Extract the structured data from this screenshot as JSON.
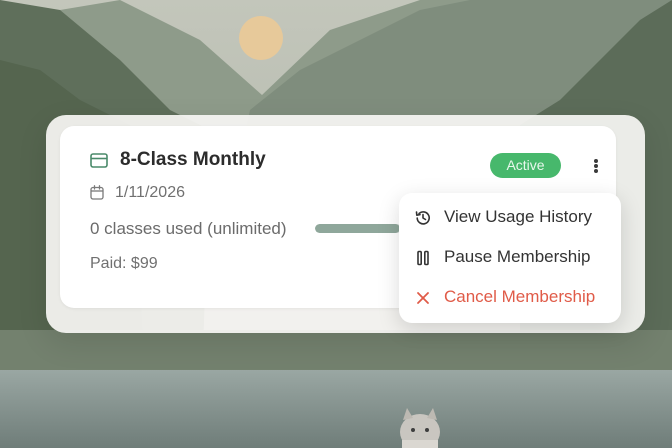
{
  "membership": {
    "plan_name": "8-Class Monthly",
    "plan_icon": "credit-card-icon",
    "date_icon": "calendar-icon",
    "date": "1/11/2026",
    "usage": "0 classes used (unlimited)",
    "usage_progress": 0.85,
    "paid": "Paid: $99",
    "status": "Active",
    "status_color": "#47b86c",
    "more_icon": "more-vertical-icon"
  },
  "menu": {
    "items": [
      {
        "label": "View Usage History",
        "icon": "history-icon"
      },
      {
        "label": "Pause Membership",
        "icon": "pause-icon"
      },
      {
        "label": "Cancel Membership",
        "icon": "close-icon",
        "color": "#e05b48"
      }
    ]
  },
  "background": {
    "description_icon": "mountain-lake-scene"
  }
}
